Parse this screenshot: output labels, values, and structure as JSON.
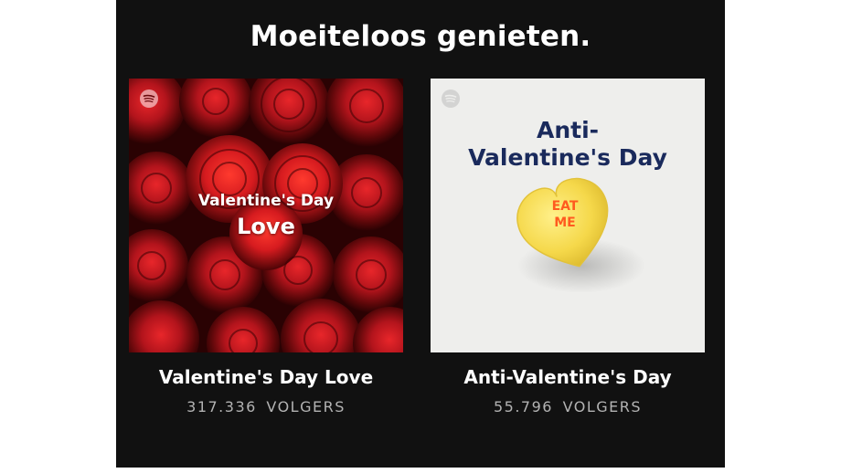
{
  "section": {
    "heading": "Moeiteloos genieten."
  },
  "playlists": [
    {
      "cover_line1": "Valentine's Day",
      "cover_line2": "Love",
      "title": "Valentine's Day Love",
      "follower_count": "317.336",
      "follower_label": "VOLGERS"
    },
    {
      "cover_line1": "Anti-",
      "cover_line2": "Valentine's Day",
      "heart_line1": "EAT",
      "heart_line2": "ME",
      "title": "Anti-Valentine's Day",
      "follower_count": "55.796",
      "follower_label": "VOLGERS"
    }
  ],
  "colors": {
    "panel_background": "#111111",
    "rose_red": "#b3141c",
    "anti_background": "#eeeeec",
    "anti_title": "#1a2a5c",
    "heart_yellow": "#f5d84a",
    "heart_text": "#ff5a1f",
    "muted_text": "#b3b3b3"
  },
  "icons": {
    "cover_badge": "spotify-logo-icon"
  }
}
